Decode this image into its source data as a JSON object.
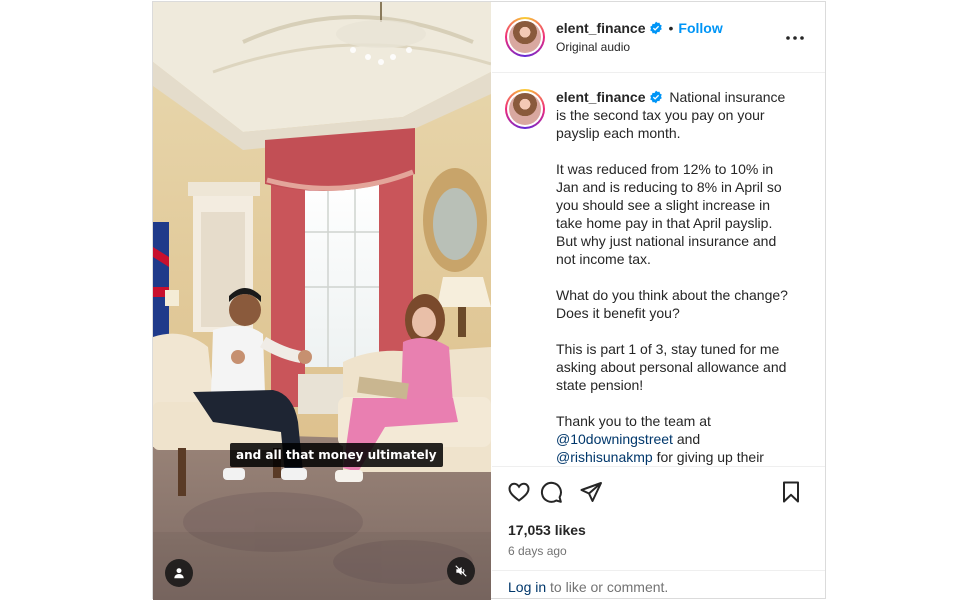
{
  "video": {
    "subtitle": "and all that money ultimately"
  },
  "header": {
    "username": "elent_finance",
    "separator": "•",
    "follow_label": "Follow",
    "audio_label": "Original audio"
  },
  "caption": {
    "username": "elent_finance",
    "paragraphs": [
      "National insurance is the second tax you pay on your payslip each month.",
      "It was reduced from 12% to 10% in Jan and is reducing to 8% in April so you should see a slight increase in take home pay in that April payslip. But why just national insurance and not income tax.",
      "What do you think about the change? Does it benefit you?",
      "This is part 1 of 3, stay tuned for me asking about personal allowance and state pension!"
    ],
    "thanks_text": "Thank you to the team at",
    "mention_1": "@10downingstreet",
    "and_text": "and",
    "mention_2": "@rishisunakmp",
    "tail_text": "for giving up their"
  },
  "stats": {
    "likes": "17,053 likes",
    "time_ago": "6 days ago"
  },
  "footer": {
    "login_link": "Log in",
    "login_suffix": "to like or comment."
  },
  "icons": {
    "like": "heart-icon",
    "comment": "comment-icon",
    "share": "share-icon",
    "save": "bookmark-icon",
    "more": "more-options-icon",
    "verified": "verified-badge-icon",
    "mute": "audio-muted-icon",
    "tags": "user-tag-icon"
  },
  "colors": {
    "accent": "#0095f6",
    "mention": "#00376b",
    "muted_text": "#737373",
    "verified": "#0095f6"
  }
}
